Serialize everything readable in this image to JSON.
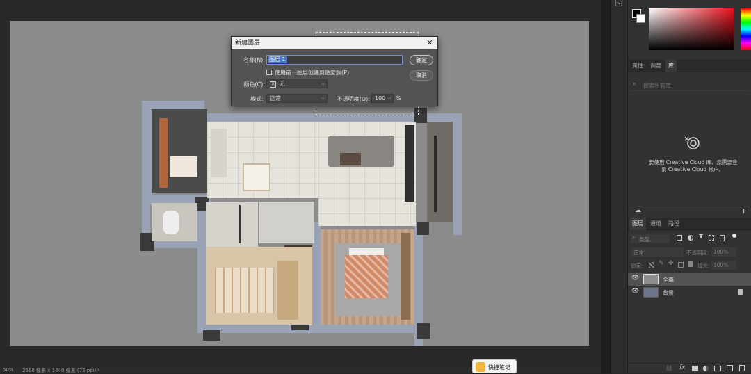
{
  "status_bar": {
    "zoom": "50%",
    "doc_info": "2560 像素 x 1440 像素 (72 ppi)",
    "arrow": "›"
  },
  "dialog": {
    "title": "新建图层",
    "close_glyph": "✕",
    "name_label": "名称(N):",
    "name_value": "图层 1",
    "clip_checkbox_label": "使用前一图层创建剪贴蒙版(P)",
    "clip_checked": false,
    "color_label": "颜色(C):",
    "color_icon": "✕",
    "color_value": "无",
    "mode_label": "模式:",
    "mode_value": "正常",
    "opacity_label": "不透明度(O):",
    "opacity_value": "100",
    "opacity_unit": "%",
    "ok_label": "确定",
    "cancel_label": "取消"
  },
  "library_panel": {
    "tabs": [
      {
        "label": "属性",
        "active": false
      },
      {
        "label": "调整",
        "active": false
      },
      {
        "label": "库",
        "active": true
      }
    ],
    "search_placeholder": "搜索所有库",
    "cc_message_line1": "要使用 Creative Cloud 库，您需要登",
    "cc_message_line2": "录 Creative Cloud 帐户。"
  },
  "layers_panel": {
    "tabs": [
      {
        "label": "图层",
        "active": true
      },
      {
        "label": "通道",
        "active": false
      },
      {
        "label": "路径",
        "active": false
      }
    ],
    "filter_label": "类型",
    "blend_mode": "正常",
    "opacity_label": "不透明度:",
    "opacity_value": "100%",
    "lock_label": "锁定:",
    "fill_label": "填充:",
    "fill_value": "100%",
    "layers": [
      {
        "name": "全高",
        "selected": true,
        "locked": false
      },
      {
        "name": "背景",
        "selected": false,
        "locked": true
      }
    ]
  },
  "taskbar_popup": {
    "label": "快捷笔记"
  },
  "colors": {
    "accent_selection": "#4a74c8",
    "panel_bg": "#323232",
    "dialog_bg": "#535353"
  }
}
